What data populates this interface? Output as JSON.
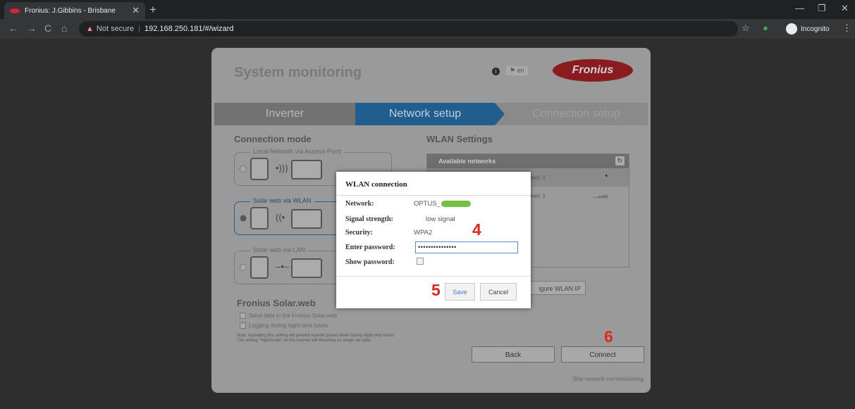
{
  "browser": {
    "tab_title": "Fronius: J.Gibbins - Brisbane",
    "tab_close": "✕",
    "new_tab": "+",
    "back": "←",
    "forward": "→",
    "reload": "C",
    "home": "⌂",
    "not_secure": "Not secure",
    "url": "192.168.250.181/#/wizard",
    "incognito": "Incognito",
    "minimize": "—",
    "restore": "❐",
    "close": "✕"
  },
  "header": {
    "title": "System monitoring",
    "info": "i",
    "language": "en",
    "logo": "Fronius"
  },
  "steps": [
    "Inverter",
    "Network setup",
    "Connection setup"
  ],
  "connection_mode": {
    "title": "Connection mode",
    "options": [
      "Local Network via Access-Point",
      "Solar web via WLAN",
      "Solar web via LAN"
    ]
  },
  "solarweb": {
    "title": "Fronius Solar.web",
    "send_data": "Send data to the Fronius Solar.web",
    "logging": "Logging during night-time hours",
    "note": "Note: Activating this setting will prevent inverter power-down during night-time hours. The setting \"Nightmode\" on the inverter will therefore no longer be valid."
  },
  "wlan": {
    "title": "WLAN Settings",
    "available_networks": "Available networks",
    "rows": [
      {
        "channel": "nnel: 1"
      },
      {
        "channel": "nnel: 1"
      }
    ],
    "configure_btn": "igure WLAN IP"
  },
  "buttons": {
    "back": "Back",
    "connect": "Connect",
    "skip": "Skip network commissioning"
  },
  "modal": {
    "title": "WLAN connection",
    "network_label": "Network:",
    "network_value": "OPTUS_",
    "signal_label": "Signal strength:",
    "signal_value": "low signal",
    "security_label": "Security:",
    "security_value": "WPA2",
    "password_label": "Enter password:",
    "password_value": "•••••••••••••••",
    "show_password_label": "Show password:",
    "save": "Save",
    "cancel": "Cancel"
  },
  "annotations": [
    "4",
    "5",
    "6"
  ]
}
